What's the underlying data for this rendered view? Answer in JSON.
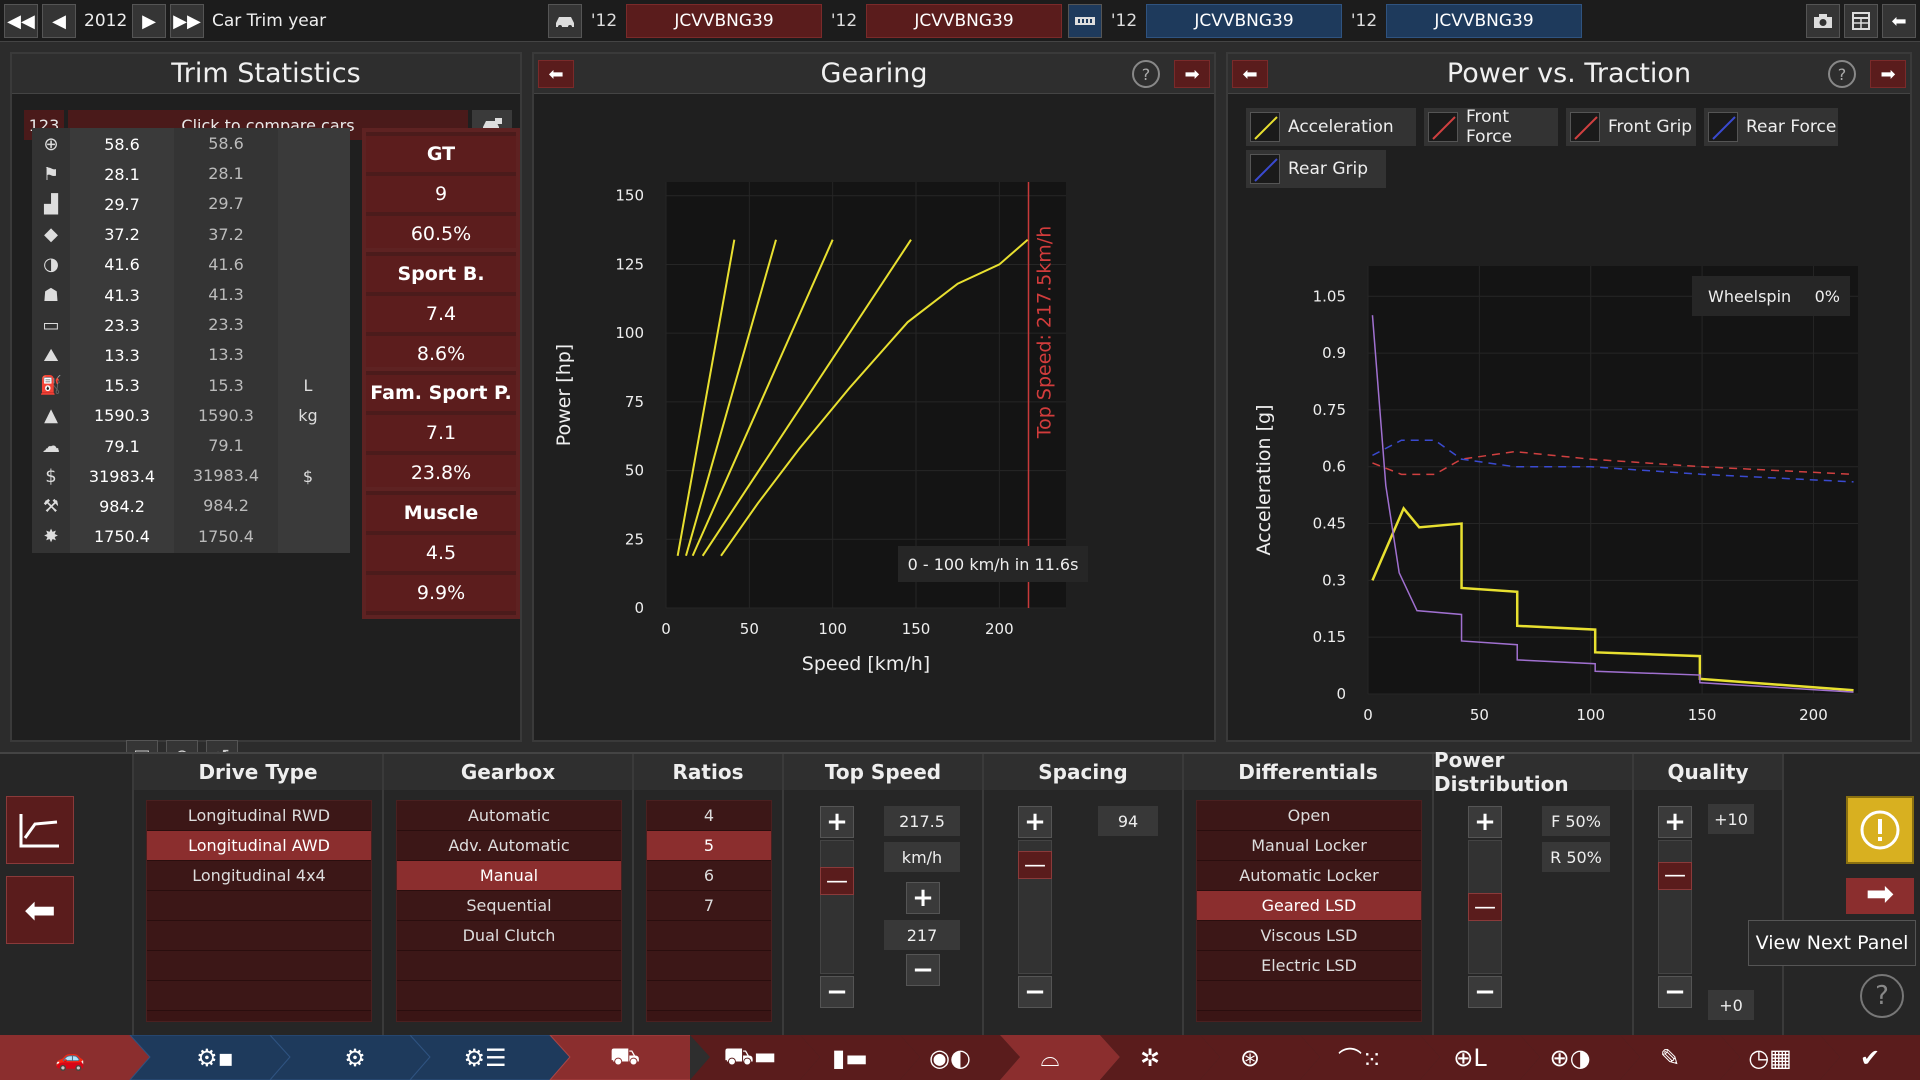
{
  "topbar": {
    "year": "2012",
    "mode_label": "Car Trim year",
    "cars": [
      {
        "year": "'12",
        "code": "JCVVBNG39"
      },
      {
        "year": "'12",
        "code": "JCVVBNG39"
      },
      {
        "year": "'12",
        "code": "JCVVBNG39"
      },
      {
        "year": "'12",
        "code": "JCVVBNG39"
      }
    ]
  },
  "trim_stats": {
    "title": "Trim Statistics",
    "counter": "123",
    "compare_label": "Click to compare cars",
    "rows": [
      {
        "icon": "steering-wheel-icon",
        "v1": "58.6",
        "v2": "58.6",
        "unit": ""
      },
      {
        "icon": "race-flag-icon",
        "v1": "28.1",
        "v2": "28.1",
        "unit": ""
      },
      {
        "icon": "seat-icon",
        "v1": "29.7",
        "v2": "29.7",
        "unit": ""
      },
      {
        "icon": "diamond-icon",
        "v1": "37.2",
        "v2": "37.2",
        "unit": ""
      },
      {
        "icon": "safety-icon",
        "v1": "41.6",
        "v2": "41.6",
        "unit": ""
      },
      {
        "icon": "passengers-icon",
        "v1": "41.3",
        "v2": "41.3",
        "unit": ""
      },
      {
        "icon": "cargo-icon",
        "v1": "23.3",
        "v2": "23.3",
        "unit": ""
      },
      {
        "icon": "offroad-icon",
        "v1": "13.3",
        "v2": "13.3",
        "unit": ""
      },
      {
        "icon": "fuel-icon",
        "v1": "15.3",
        "v2": "15.3",
        "unit": "L"
      },
      {
        "icon": "weight-icon",
        "v1": "1590.3",
        "v2": "1590.3",
        "unit": "kg"
      },
      {
        "icon": "emissions-icon",
        "v1": "79.1",
        "v2": "79.1",
        "unit": ""
      },
      {
        "icon": "cost-icon",
        "v1": "31983.4",
        "v2": "31983.4",
        "unit": "$"
      },
      {
        "icon": "hours-icon",
        "v1": "984.2",
        "v2": "984.2",
        "unit": ""
      },
      {
        "icon": "service-icon",
        "v1": "1750.4",
        "v2": "1750.4",
        "unit": ""
      }
    ],
    "markets": [
      {
        "name": "GT",
        "score": "9",
        "pct": "60.5%"
      },
      {
        "name": "Sport B.",
        "score": "7.4",
        "pct": "8.6%"
      },
      {
        "name": "Fam. Sport P.",
        "score": "7.1",
        "pct": "23.8%"
      },
      {
        "name": "Muscle",
        "score": "4.5",
        "pct": "9.9%"
      }
    ]
  },
  "gearing": {
    "title": "Gearing",
    "annotation": "Top Speed: 217.5km/h",
    "accel_note": "0 - 100 km/h in 11.6s"
  },
  "power_traction": {
    "title": "Power vs. Traction",
    "legend": [
      {
        "name": "Acceleration",
        "color": "#e8e030"
      },
      {
        "name": "Front Force",
        "color": "#d04040"
      },
      {
        "name": "Front Grip",
        "color": "#d04040"
      },
      {
        "name": "Rear Force",
        "color": "#3a4ad0"
      },
      {
        "name": "Rear Grip",
        "color": "#3a4ad0"
      }
    ],
    "wheelspin_label": "Wheelspin",
    "wheelspin_value": "0%"
  },
  "chart_data": [
    {
      "type": "line",
      "title": "Gearing",
      "xlabel": "Speed [km/h]",
      "ylabel": "Power [hp]",
      "xlim": [
        0,
        240
      ],
      "ylim": [
        0,
        155
      ],
      "xticks": [
        0,
        50,
        100,
        150,
        200
      ],
      "yticks": [
        0,
        25,
        50,
        75,
        100,
        125,
        150
      ],
      "top_speed_marker": 217.5,
      "series": [
        {
          "color": "#e8e030",
          "x": [
            7,
            41
          ],
          "y": [
            19,
            134
          ]
        },
        {
          "color": "#e8e030",
          "x": [
            12,
            66
          ],
          "y": [
            19,
            134
          ]
        },
        {
          "color": "#e8e030",
          "x": [
            16,
            100
          ],
          "y": [
            19,
            134
          ]
        },
        {
          "color": "#e8e030",
          "x": [
            22,
            147
          ],
          "y": [
            19,
            134
          ]
        },
        {
          "color": "#e8e030",
          "x": [
            33,
            55,
            80,
            110,
            145,
            175,
            200,
            217
          ],
          "y": [
            19,
            38,
            58,
            80,
            104,
            118,
            125,
            134
          ]
        }
      ]
    },
    {
      "type": "line",
      "title": "Power vs. Traction",
      "xlabel": "Speed [km/h]",
      "ylabel": "Acceleration [g]",
      "xlim": [
        0,
        220
      ],
      "ylim": [
        0,
        1.13
      ],
      "xticks": [
        0,
        50,
        100,
        150,
        200
      ],
      "yticks": [
        0,
        0.15,
        0.3,
        0.45,
        0.6,
        0.75,
        0.9,
        1.05
      ],
      "series": [
        {
          "name": "Acceleration",
          "color": "#e8e030",
          "x": [
            2,
            16,
            23,
            42,
            42,
            67,
            67,
            102,
            102,
            149,
            149,
            218
          ],
          "y": [
            0.3,
            0.49,
            0.44,
            0.45,
            0.28,
            0.27,
            0.18,
            0.17,
            0.11,
            0.1,
            0.04,
            0.01
          ]
        },
        {
          "name": "Front Force",
          "color": "#d04040",
          "x": [
            2,
            15,
            30,
            42,
            66,
            100,
            150,
            218
          ],
          "y": [
            0.61,
            0.58,
            0.58,
            0.62,
            0.64,
            0.62,
            0.6,
            0.58
          ]
        },
        {
          "name": "Rear Force",
          "color": "#3a4ad0",
          "x": [
            2,
            15,
            30,
            42,
            66,
            100,
            150,
            218
          ],
          "y": [
            0.63,
            0.67,
            0.67,
            0.62,
            0.6,
            0.6,
            0.58,
            0.56
          ]
        },
        {
          "name": "Front Grip",
          "color": "#d04040",
          "x": [
            2,
            218
          ],
          "y": [
            0.6,
            0.58
          ]
        },
        {
          "name": "Rear Grip",
          "color": "#3a4ad0",
          "x": [
            2,
            218
          ],
          "y": [
            0.6,
            0.56
          ]
        },
        {
          "color": "#a070d0",
          "x": [
            2,
            8,
            14,
            22,
            42,
            42,
            67,
            67,
            102,
            102,
            149,
            149,
            218
          ],
          "y": [
            1.0,
            0.55,
            0.32,
            0.22,
            0.21,
            0.14,
            0.13,
            0.09,
            0.08,
            0.06,
            0.05,
            0.03,
            0.005
          ]
        }
      ]
    }
  ],
  "bottom": {
    "drive_type": {
      "title": "Drive Type",
      "items": [
        "Longitudinal RWD",
        "Longitudinal AWD",
        "Longitudinal 4x4"
      ],
      "selected": "Longitudinal AWD"
    },
    "gearbox": {
      "title": "Gearbox",
      "items": [
        "Automatic",
        "Adv. Automatic",
        "Manual",
        "Sequential",
        "Dual Clutch"
      ],
      "selected": "Manual"
    },
    "ratios": {
      "title": "Ratios",
      "items": [
        "4",
        "5",
        "6",
        "7"
      ],
      "selected": "5"
    },
    "top_speed": {
      "title": "Top Speed",
      "value": "217.5",
      "unit": "km/h",
      "target": "217",
      "level": 0.75
    },
    "spacing": {
      "title": "Spacing",
      "value": "94",
      "level": 0.9
    },
    "differentials": {
      "title": "Differentials",
      "items": [
        "Open",
        "Manual Locker",
        "Automatic Locker",
        "Geared LSD",
        "Viscous LSD",
        "Electric LSD"
      ],
      "selected": "Geared LSD"
    },
    "power_distribution": {
      "title": "Power Distribution",
      "front": "F 50%",
      "rear": "R 50%",
      "level": 0.5
    },
    "quality": {
      "title": "Quality",
      "top": "+10",
      "bottom": "+0",
      "level": 0.8
    },
    "tooltip": "View Next Panel"
  },
  "colors": {
    "accent_red": "#5a1c1c",
    "selected_red": "#8b2e2e",
    "car_blue": "#1e3a5c",
    "warning_yellow": "#d8b020"
  }
}
